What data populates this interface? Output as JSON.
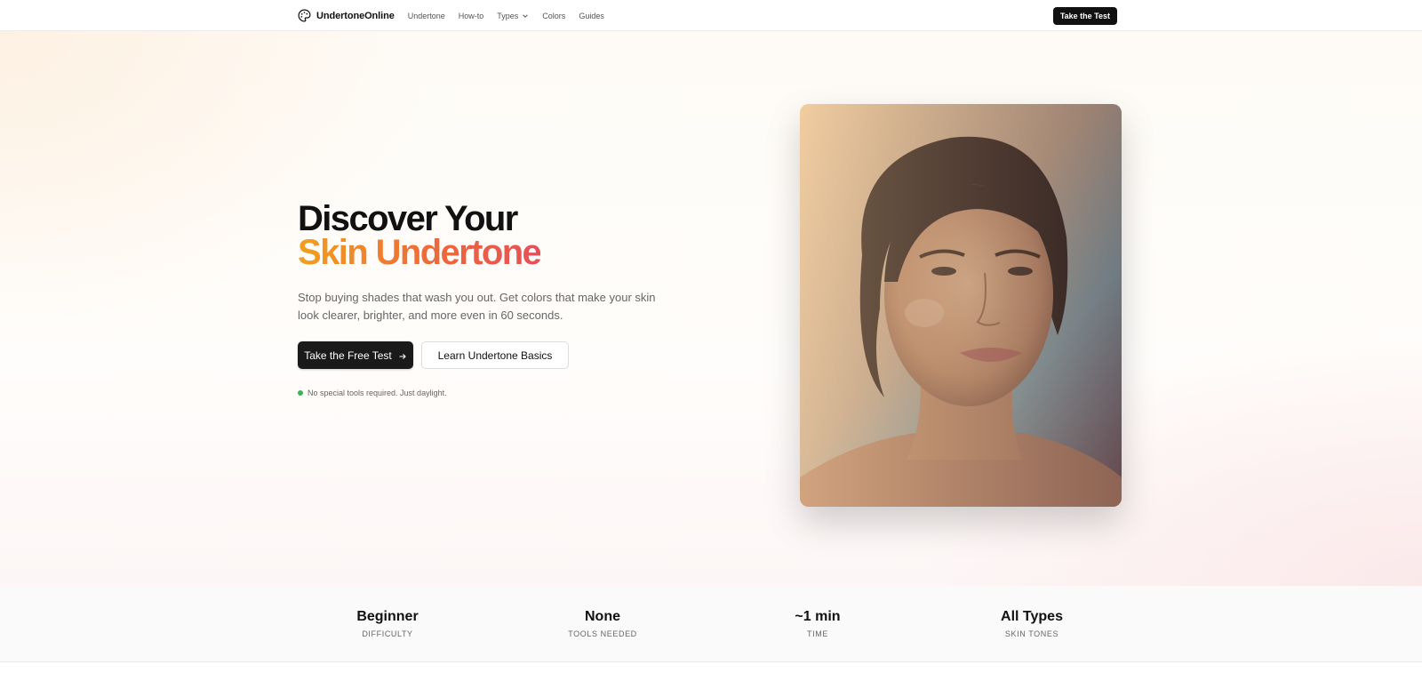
{
  "nav": {
    "brand": "UndertoneOnline",
    "links": [
      "Undertone",
      "How-to",
      "Types",
      "Colors",
      "Guides"
    ],
    "cta": "Take the Test"
  },
  "hero": {
    "title_line1": "Discover Your",
    "title_line2": "Skin Undertone",
    "subtitle": "Stop buying shades that wash you out. Get colors that make your skin look clearer, brighter, and more even in 60 seconds.",
    "primary_cta": "Take the Free Test",
    "secondary_cta": "Learn Undertone Basics",
    "note": "No special tools required. Just daylight."
  },
  "stats": [
    {
      "value": "Beginner",
      "label": "DIFFICULTY"
    },
    {
      "value": "None",
      "label": "TOOLS NEEDED"
    },
    {
      "value": "~1 min",
      "label": "TIME"
    },
    {
      "value": "All Types",
      "label": "SKIN TONES"
    }
  ],
  "colors": {
    "accent_start": "#f0a020",
    "accent_end": "#e4505a",
    "primary_button": "#1a1a1a",
    "status_dot": "#3cb45a"
  },
  "icons": {
    "brand": "palette-icon",
    "types_dropdown": "chevron-down-icon",
    "primary_cta": "arrow-right-icon"
  }
}
